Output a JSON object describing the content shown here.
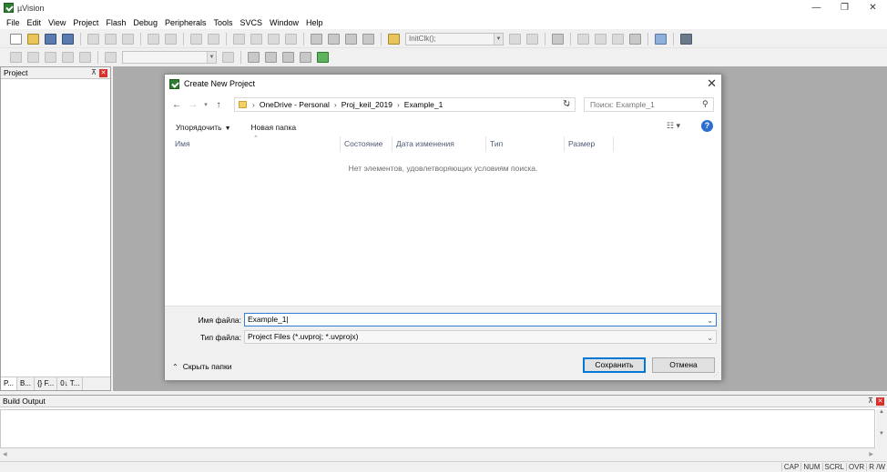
{
  "app": {
    "title": "µVision",
    "accent": "#2f7d32"
  },
  "window_controls": {
    "minimize": "—",
    "restore": "❐",
    "close": "✕"
  },
  "menu": [
    "File",
    "Edit",
    "View",
    "Project",
    "Flash",
    "Debug",
    "Peripherals",
    "Tools",
    "SVCS",
    "Window",
    "Help"
  ],
  "toolbar": {
    "target_combo": "InitClk();"
  },
  "project_panel": {
    "title": "Project",
    "tabs": [
      "P...",
      "B...",
      "{} F...",
      "0↓ T..."
    ]
  },
  "build_output": {
    "title": "Build Output"
  },
  "status_bar": [
    "CAP",
    "NUM",
    "SCRL",
    "OVR",
    "R /W"
  ],
  "dialog": {
    "title": "Create New Project",
    "breadcrumbs": [
      "OneDrive - Personal",
      "Proj_keil_2019",
      "Example_1"
    ],
    "search_placeholder": "Поиск: Example_1",
    "organize_label": "Упорядочить",
    "new_folder_label": "Новая папка",
    "columns": [
      "Имя",
      "Состояние",
      "Дата изменения",
      "Тип",
      "Размер"
    ],
    "empty_message": "Нет элементов, удовлетворяющих условиям поиска.",
    "filename_label": "Имя файла:",
    "filename_value": "Example_1",
    "filetype_label": "Тип файла:",
    "filetype_value": "Project Files (*.uvproj; *.uvprojx)",
    "hide_folders_label": "Скрыть папки",
    "save_label": "Сохранить",
    "cancel_label": "Отмена",
    "help_color": "#2c6fd1"
  }
}
